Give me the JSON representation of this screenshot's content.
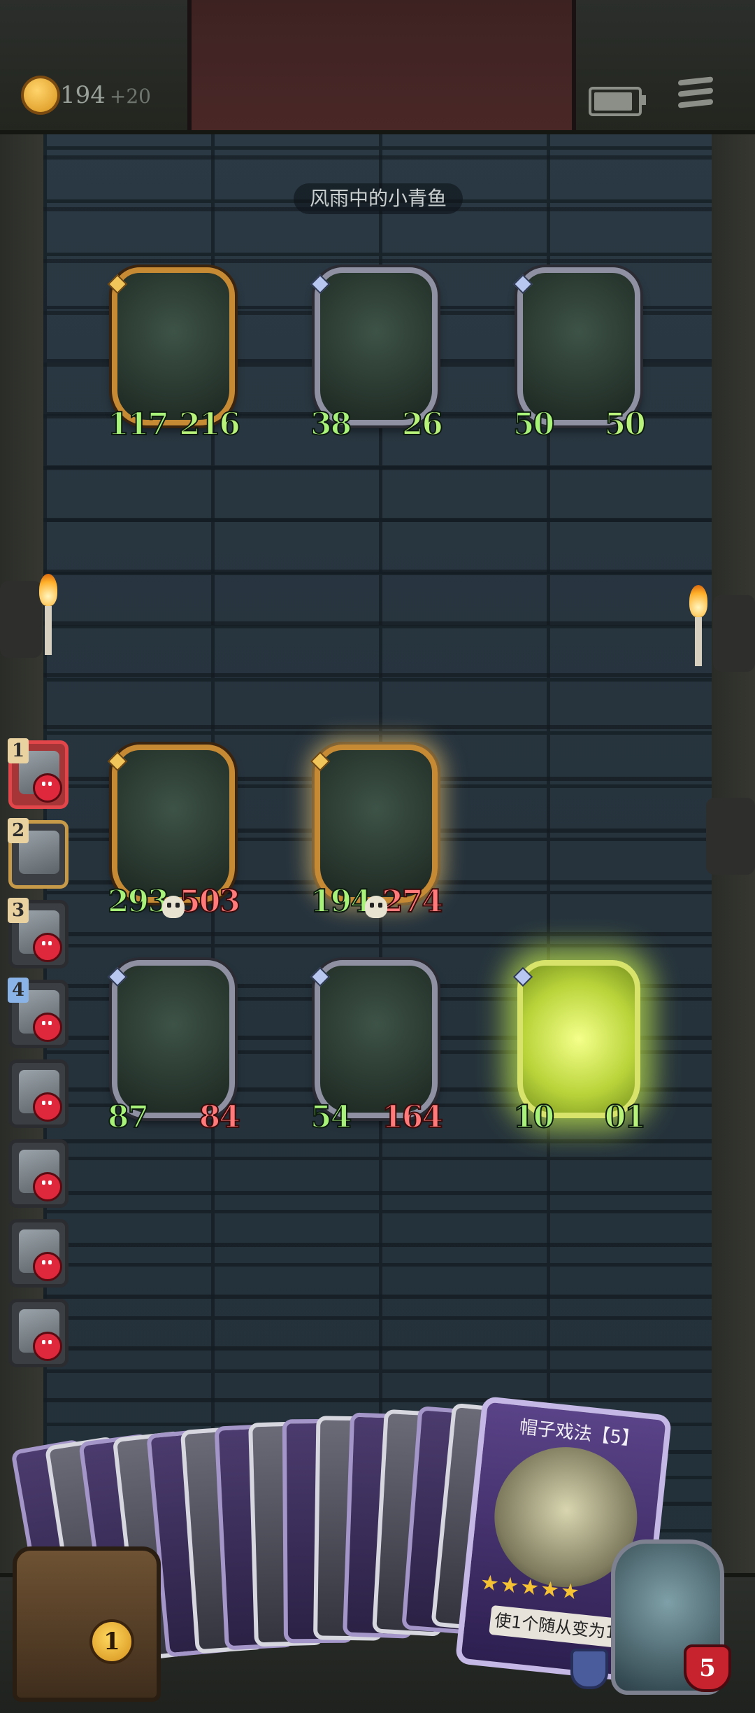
{
  "header": {
    "gold": "194",
    "gold_bonus": "+20",
    "battery_level": 0.9
  },
  "opponent_name": "风雨中的小青鱼",
  "enemy_board": [
    {
      "name": "green-dragon-minion",
      "attack": "117",
      "health": "216",
      "frame": "gold"
    },
    {
      "name": "armored-knight-minion",
      "attack": "38",
      "health": "26",
      "frame": "silver"
    },
    {
      "name": "red-demon-dragon-minion",
      "attack": "50",
      "health": "50",
      "frame": "silver"
    }
  ],
  "player_board_row1": [
    {
      "name": "treant-minion",
      "attack": "293",
      "health": "503",
      "frame": "gold"
    },
    {
      "name": "leaf-sprout-minion",
      "attack": "194",
      "health": "274",
      "frame": "gold"
    }
  ],
  "player_board_row2": [
    {
      "name": "elf-sorceress-minion",
      "attack": "87",
      "health": "84",
      "frame": "silver"
    },
    {
      "name": "mushroom-creature-minion",
      "attack": "54",
      "health": "164",
      "frame": "silver"
    },
    {
      "name": "glowing-minion",
      "attack": "10",
      "health": "01",
      "frame": "glow"
    }
  ],
  "turn_order": [
    {
      "rank": "1",
      "state": "active-dead"
    },
    {
      "rank": "2",
      "state": "alive"
    },
    {
      "rank": "3",
      "state": "dead"
    },
    {
      "rank": "4",
      "state": "dead"
    },
    {
      "rank": "",
      "state": "dead"
    },
    {
      "rank": "",
      "state": "dead"
    },
    {
      "rank": "",
      "state": "dead"
    },
    {
      "rank": "",
      "state": "dead"
    }
  ],
  "featured_card": {
    "name": "帽子戏法【5】",
    "stars": "★★★★★",
    "description": "使1个随从变为10"
  },
  "chest_count": "1",
  "hero_health": "5"
}
